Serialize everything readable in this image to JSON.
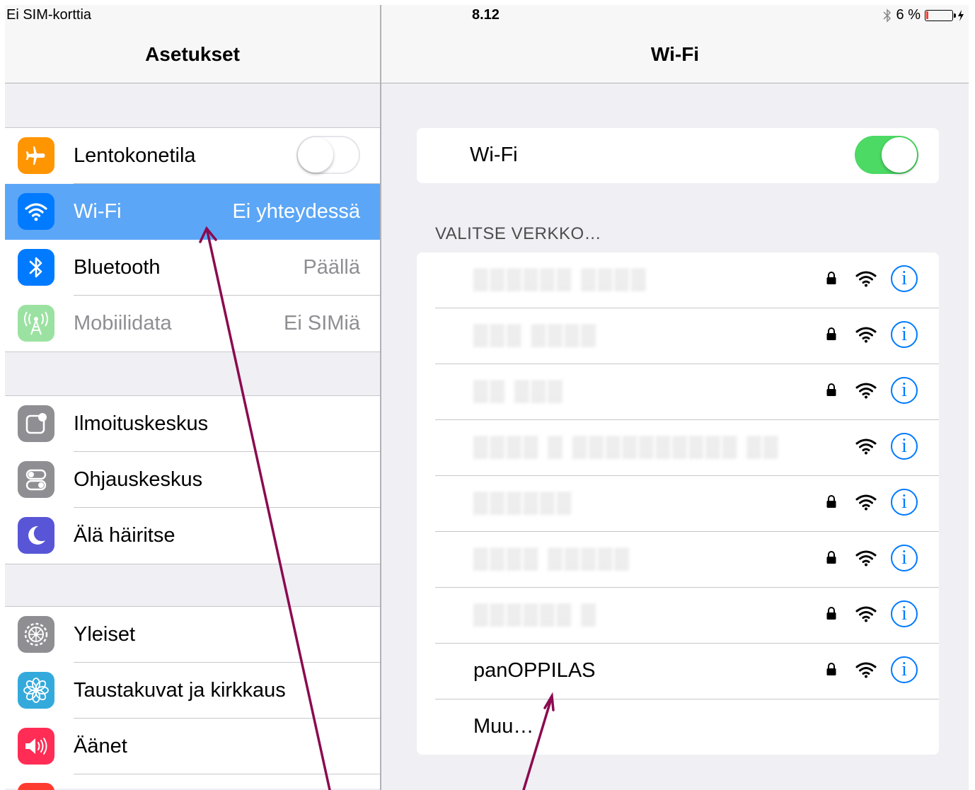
{
  "status_bar": {
    "carrier": "Ei SIM-korttia",
    "time": "8.12",
    "battery": "6 %"
  },
  "settings": {
    "title": "Asetukset",
    "group1": [
      {
        "label": "Lentokonetila",
        "detail": "",
        "icon": "airplane-icon",
        "color": "#ff9500"
      },
      {
        "label": "Wi-Fi",
        "detail": "Ei yhteydessä",
        "icon": "wifi-icon",
        "color": "#007aff"
      },
      {
        "label": "Bluetooth",
        "detail": "Päällä",
        "icon": "bluetooth-icon",
        "color": "#007aff"
      },
      {
        "label": "Mobiilidata",
        "detail": "Ei SIMiä",
        "icon": "antenna-icon",
        "color": "#9be2a2"
      }
    ],
    "group2": [
      {
        "label": "Ilmoituskeskus",
        "icon": "notification-center-icon",
        "color": "#8e8e93"
      },
      {
        "label": "Ohjauskeskus",
        "icon": "control-center-icon",
        "color": "#8e8e93"
      },
      {
        "label": "Älä häiritse",
        "icon": "moon-icon",
        "color": "#5856d6"
      }
    ],
    "group3": [
      {
        "label": "Yleiset",
        "icon": "gear-icon",
        "color": "#8e8e93"
      },
      {
        "label": "Taustakuvat ja kirkkaus",
        "icon": "flower-icon",
        "color": "#34aadc"
      },
      {
        "label": "Äänet",
        "icon": "speaker-icon",
        "color": "#ff2d55"
      }
    ]
  },
  "wifi": {
    "title": "Wi-Fi",
    "toggle_label": "Wi-Fi",
    "section_header": "VALITSE VERKKO…",
    "networks": [
      {
        "name": "▒▒▒▒▒▒ ▒▒▒▒",
        "locked": true,
        "hidden_name": true
      },
      {
        "name": "▒▒▒ ▒▒▒▒",
        "locked": true,
        "hidden_name": true
      },
      {
        "name": "▒▒ ▒▒▒",
        "locked": true,
        "hidden_name": true
      },
      {
        "name": "▒▒▒▒ ▒ ▒▒▒▒▒▒▒▒▒▒ ▒▒",
        "locked": false,
        "hidden_name": true
      },
      {
        "name": "▒▒▒▒▒▒",
        "locked": true,
        "hidden_name": true
      },
      {
        "name": "▒▒▒▒ ▒▒▒▒▒",
        "locked": true,
        "hidden_name": true
      },
      {
        "name": "▒▒▒▒▒▒ ▒",
        "locked": true,
        "hidden_name": true
      },
      {
        "name": "panOPPILAS",
        "locked": true,
        "hidden_name": false
      }
    ],
    "other": "Muu…"
  },
  "colors": {
    "annotation_arrow": "#8b0a50",
    "toggle_on": "#4cd964",
    "selected_row": "#5ba6f7",
    "info_blue": "#007aff"
  }
}
